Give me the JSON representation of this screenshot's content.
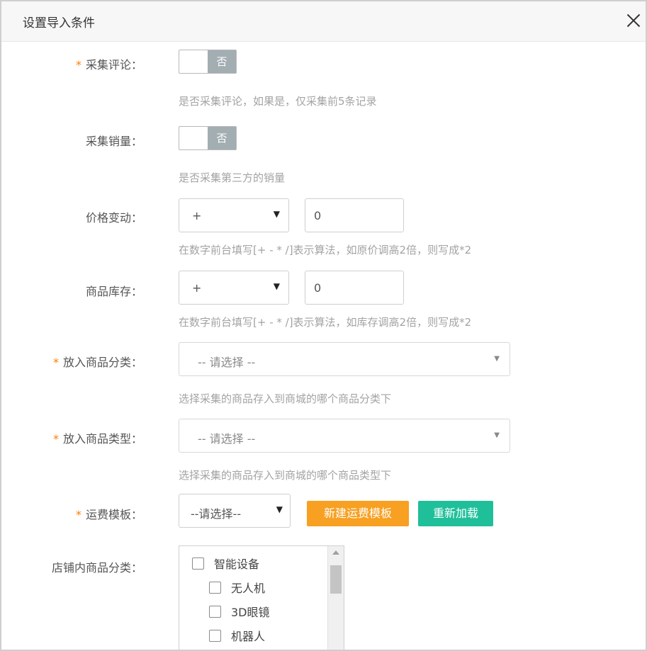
{
  "dialog": {
    "title": "设置导入条件"
  },
  "form": {
    "collect_comments": {
      "required_mark": "*",
      "label": "采集评论：",
      "toggle_text": "否",
      "hint": "是否采集评论，如果是，仅采集前5条记录"
    },
    "collect_sales": {
      "label": "采集销量：",
      "toggle_text": "否",
      "hint": "是否采集第三方的销量"
    },
    "price_change": {
      "label": "价格变动：",
      "operator": "+",
      "value": "0",
      "hint": "在数字前台填写[+ - * /]表示算法，如原价调高2倍，则写成*2"
    },
    "stock": {
      "label": "商品库存：",
      "operator": "+",
      "value": "0",
      "hint": "在数字前台填写[+ - * /]表示算法，如库存调高2倍，则写成*2"
    },
    "category": {
      "required_mark": "*",
      "label": "放入商品分类：",
      "selected": "-- 请选择 --",
      "hint": "选择采集的商品存入到商城的哪个商品分类下"
    },
    "product_type": {
      "required_mark": "*",
      "label": "放入商品类型：",
      "selected": "-- 请选择 --",
      "hint": "选择采集的商品存入到商城的哪个商品类型下"
    },
    "shipping_template": {
      "required_mark": "*",
      "label": "运费模板：",
      "selected": "--请选择--",
      "new_button": "新建运费模板",
      "reload_button": "重新加载"
    },
    "store_category": {
      "label": "店铺内商品分类：",
      "items": [
        "智能设备",
        "无人机",
        "3D眼镜",
        "机器人"
      ]
    }
  },
  "colors": {
    "required_star": "#ff7d00",
    "toggle_off_bg": "#a3aeb3",
    "new_template_button": "#f7a021",
    "reload_button": "#1fbf9a",
    "hint_text": "#a3a3a3"
  },
  "icons": {
    "close": "close-icon",
    "dropdown": "caret-down-icon",
    "scroll_up": "scroll-up-arrow-icon"
  }
}
